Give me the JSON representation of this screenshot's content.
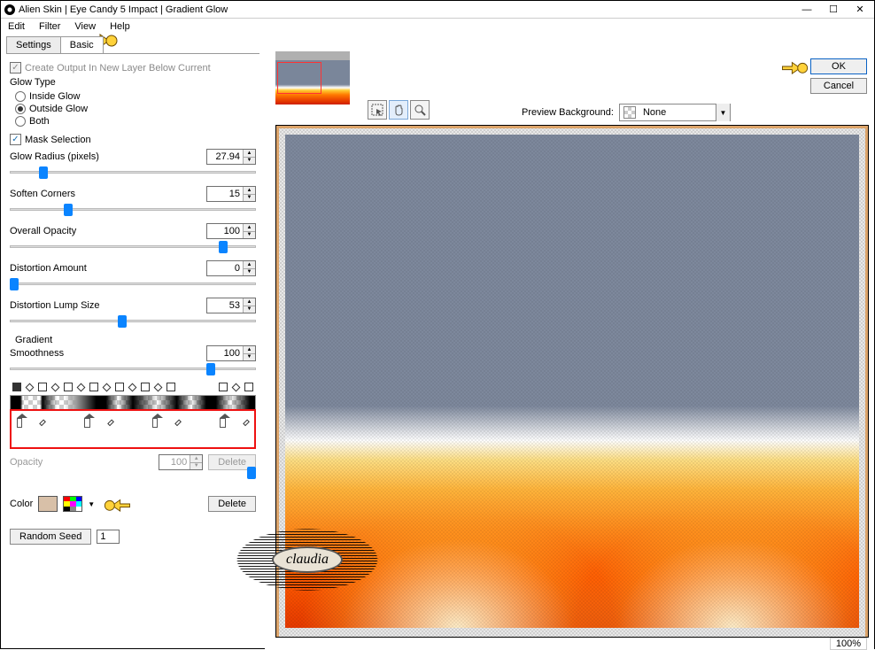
{
  "window": {
    "title": "Alien Skin | Eye Candy 5 Impact | Gradient Glow"
  },
  "menubar": {
    "items": [
      "Edit",
      "Filter",
      "View",
      "Help"
    ]
  },
  "tabs": {
    "items": [
      "Settings",
      "Basic"
    ],
    "active": 1
  },
  "panel": {
    "create_layer": {
      "label": "Create Output In New Layer Below Current",
      "checked": true
    },
    "glow_type": {
      "legend": "Glow Type",
      "options": [
        "Inside Glow",
        "Outside Glow",
        "Both"
      ],
      "selected": 1
    },
    "mask_selection": {
      "label": "Mask Selection",
      "checked": true
    },
    "params": {
      "glow_radius": {
        "label": "Glow Radius (pixels)",
        "value": "27.94",
        "pos": 12
      },
      "soften_corners": {
        "label": "Soften Corners",
        "value": "15",
        "pos": 22
      },
      "overall_opacity": {
        "label": "Overall Opacity",
        "value": "100",
        "pos": 85
      },
      "distortion_amount": {
        "label": "Distortion Amount",
        "value": "0",
        "pos": 0
      },
      "distortion_lump": {
        "label": "Distortion Lump Size",
        "value": "53",
        "pos": 44
      }
    },
    "gradient": {
      "heading": "Gradient",
      "smoothness": {
        "label": "Smoothness",
        "value": "100",
        "pos": 80
      }
    },
    "opacity": {
      "label": "Opacity",
      "value": "100",
      "delete": "Delete"
    },
    "color": {
      "label": "Color",
      "delete": "Delete"
    },
    "random_seed": {
      "label": "Random Seed",
      "value": "1"
    }
  },
  "right": {
    "tools": [
      "selection",
      "hand",
      "zoom"
    ],
    "preview_bg_label": "Preview Background:",
    "preview_bg_value": "None",
    "ok": "OK",
    "cancel": "Cancel",
    "zoom": "100%"
  },
  "watermark": "claudia"
}
